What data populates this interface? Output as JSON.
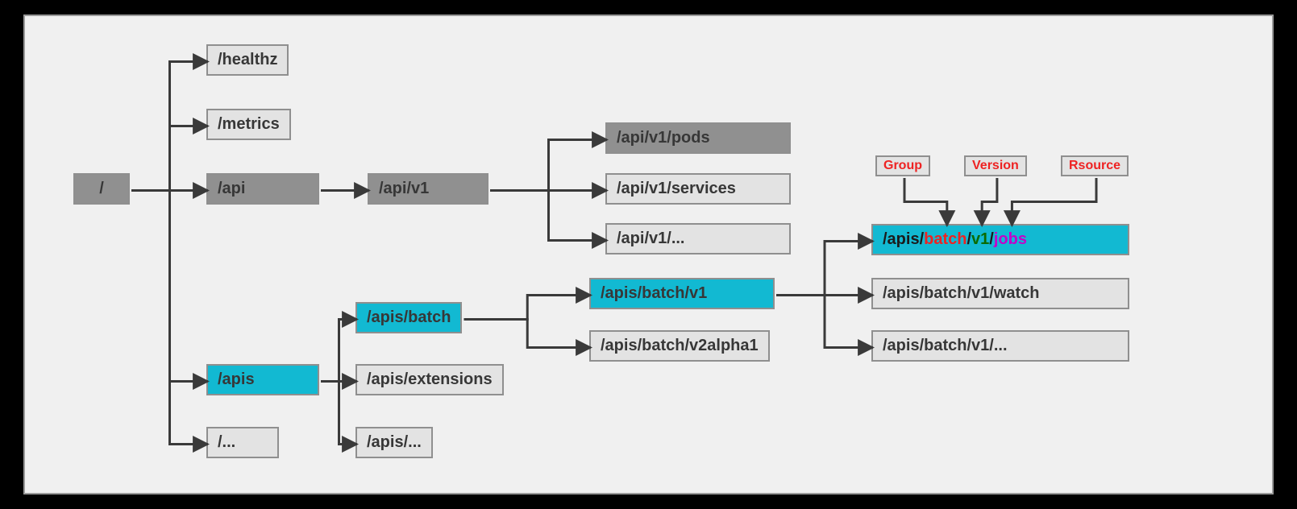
{
  "colors": {
    "gray": "#909090",
    "light": "#e3e3e3",
    "teal": "#12b9d2",
    "red": "#e22",
    "green": "#0b6b00",
    "magenta": "#c400c9",
    "text": "#373737"
  },
  "nodes": {
    "root": "/",
    "healthz": "/healthz",
    "metrics": "/metrics",
    "api": "/api",
    "apis": "/apis",
    "root_ell": "/...",
    "api_v1": "/api/v1",
    "api_v1_pods": "/api/v1/pods",
    "api_v1_services": "/api/v1/services",
    "api_v1_ell": "/api/v1/...",
    "apis_batch": "/apis/batch",
    "apis_extensions": "/apis/extensions",
    "apis_ell": "/apis/...",
    "apis_batch_v1": "/apis/batch/v1",
    "apis_batch_v2a1": "/apis/batch/v2alpha1",
    "gvr_prefix": "/apis/",
    "gvr_group": "batch",
    "gvr_sep1": "/",
    "gvr_version": "v1",
    "gvr_sep2": "/",
    "gvr_resource": "jobs",
    "apis_batch_v1_watch": "/apis/batch/v1/watch",
    "apis_batch_v1_ell": "/apis/batch/v1/..."
  },
  "labels": {
    "group": "Group",
    "version": "Version",
    "resource": "Rsource"
  }
}
